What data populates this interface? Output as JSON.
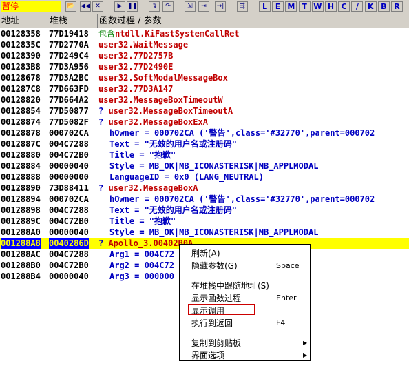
{
  "toolbar": {
    "status": "暂停",
    "letters": [
      "L",
      "E",
      "M",
      "T",
      "W",
      "H",
      "C",
      "/",
      "K",
      "B",
      "R"
    ]
  },
  "header": {
    "addr": "地址",
    "stack": "堆栈",
    "proc": "函数过程 / 参数"
  },
  "rows": [
    {
      "addr": "00128358",
      "val": "77D19418",
      "prefix": "包含",
      "text": "ntdll.KiFastSystemCallRet",
      "kind": "func"
    },
    {
      "addr": "0012835C",
      "val": "77D2770A",
      "text": "user32.WaitMessage",
      "kind": "func"
    },
    {
      "addr": "00128390",
      "val": "77D249C4",
      "text": "user32.77D2757B",
      "kind": "func"
    },
    {
      "addr": "001283B8",
      "val": "77D3A956",
      "text": "user32.77D2490E",
      "kind": "func"
    },
    {
      "addr": "00128678",
      "val": "77D3A2BC",
      "text": "user32.SoftModalMessageBox",
      "kind": "func"
    },
    {
      "addr": "001287C8",
      "val": "77D663FD",
      "text": "user32.77D3A147",
      "kind": "func"
    },
    {
      "addr": "00128820",
      "val": "77D664A2",
      "text": "user32.MessageBoxTimeoutW",
      "kind": "func"
    },
    {
      "addr": "00128854",
      "val": "77D50877",
      "q": "? ",
      "text": "user32.MessageBoxTimeoutA",
      "kind": "func"
    },
    {
      "addr": "00128874",
      "val": "77D5082F",
      "q": "? ",
      "text": "user32.MessageBoxExA",
      "kind": "func"
    },
    {
      "addr": "00128878",
      "val": "000702CA",
      "text": "hOwner = 000702CA ('警告',class='#32770',parent=000702",
      "kind": "param"
    },
    {
      "addr": "0012887C",
      "val": "004C7288",
      "text": "Text = \"无效的用户名或注册码\"",
      "kind": "param"
    },
    {
      "addr": "00128880",
      "val": "004C72B0",
      "text": "Title = \"抱歉\"",
      "kind": "param"
    },
    {
      "addr": "00128884",
      "val": "00000040",
      "text": "Style = MB_OK|MB_ICONASTERISK|MB_APPLMODAL",
      "kind": "param"
    },
    {
      "addr": "00128888",
      "val": "00000000",
      "text": "LanguageID = 0x0 (LANG_NEUTRAL)",
      "kind": "param"
    },
    {
      "addr": "00128890",
      "val": "73D88411",
      "q": "? ",
      "text": "user32.MessageBoxA",
      "kind": "func"
    },
    {
      "addr": "00128894",
      "val": "000702CA",
      "text": "hOwner = 000702CA ('警告',class='#32770',parent=000702",
      "kind": "param"
    },
    {
      "addr": "00128898",
      "val": "004C7288",
      "text": "Text = \"无效的用户名或注册码\"",
      "kind": "param"
    },
    {
      "addr": "0012889C",
      "val": "004C72B0",
      "text": "Title = \"抱歉\"",
      "kind": "param"
    },
    {
      "addr": "001288A0",
      "val": "00000040",
      "text": "Style = MB_OK|MB_ICONASTERISK|MB_APPLMODAL",
      "kind": "param"
    },
    {
      "addr": "001288A8",
      "val": "0040286D",
      "q": "? ",
      "text": "Apollo_3.00402B0A",
      "kind": "func",
      "selected": true
    },
    {
      "addr": "001288AC",
      "val": "004C7288",
      "text": "Arg1 = 004C72",
      "kind": "param"
    },
    {
      "addr": "001288B0",
      "val": "004C72B0",
      "text": "Arg2 = 004C72",
      "kind": "param"
    },
    {
      "addr": "001288B4",
      "val": "00000040",
      "text": "Arg3 = 000000",
      "kind": "param"
    }
  ],
  "menu": [
    {
      "label": "刷新(A)",
      "shortcut": ""
    },
    {
      "label": "隐藏参数(G)",
      "shortcut": "Space"
    },
    {
      "sep": true
    },
    {
      "label": "在堆栈中跟随地址(S)",
      "shortcut": ""
    },
    {
      "label": "显示函数过程",
      "shortcut": "Enter"
    },
    {
      "label": "显示调用",
      "shortcut": "",
      "highlight": true
    },
    {
      "label": "执行到返回",
      "shortcut": "F4"
    },
    {
      "sep": true
    },
    {
      "label": "复制到剪贴板",
      "shortcut": "",
      "submenu": true
    },
    {
      "label": "界面选项",
      "shortcut": "",
      "submenu": true
    }
  ],
  "colors": {
    "selection": "#0000ff",
    "highlight_row": "#ffff00",
    "func_text": "#c00000",
    "param_text": "#0000c0",
    "status_bg": "#ffff00"
  }
}
